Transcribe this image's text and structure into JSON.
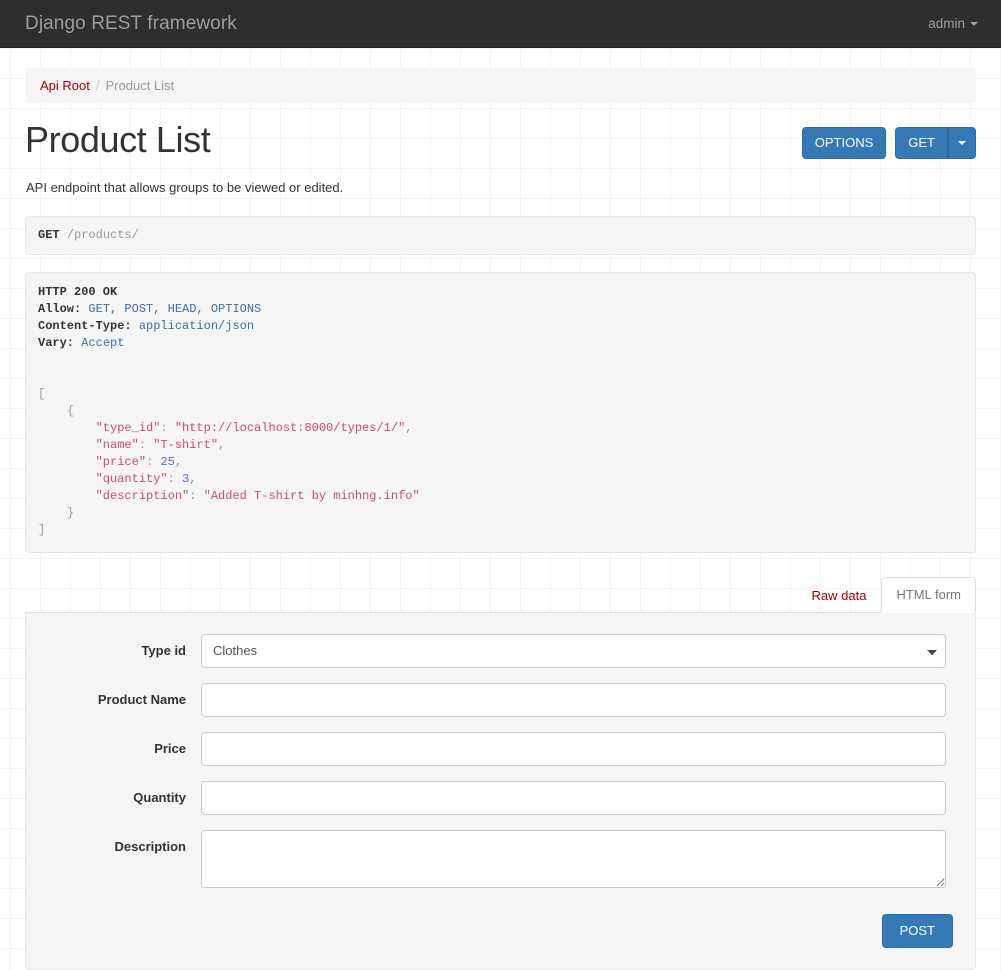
{
  "navbar": {
    "brand": "Django REST framework",
    "user": "admin",
    "caret_icon": "caret-down-icon"
  },
  "breadcrumb": {
    "root_label": "Api Root",
    "separator": "/",
    "current_label": "Product List"
  },
  "header": {
    "title": "Product List",
    "options_label": "OPTIONS",
    "get_label": "GET",
    "dropdown_icon": "caret-down-icon"
  },
  "description": "API endpoint that allows groups to be viewed or edited.",
  "request": {
    "method": "GET",
    "path": "/products/"
  },
  "response": {
    "status_line": "HTTP 200 OK",
    "headers": [
      {
        "key": "Allow:",
        "value": "GET, POST, HEAD, OPTIONS"
      },
      {
        "key": "Content-Type:",
        "value": "application/json"
      },
      {
        "key": "Vary:",
        "value": "Accept"
      }
    ],
    "body": {
      "open_bracket": "[",
      "open_brace": "{",
      "close_brace": "}",
      "close_bracket": "]",
      "fields": [
        {
          "key": "\"type_id\"",
          "colon": ": ",
          "value": "\"http://localhost:8000/types/1/\"",
          "type": "string",
          "comma": ","
        },
        {
          "key": "\"name\"",
          "colon": ": ",
          "value": "\"T-shirt\"",
          "type": "string",
          "comma": ","
        },
        {
          "key": "\"price\"",
          "colon": ": ",
          "value": "25",
          "type": "number",
          "comma": ","
        },
        {
          "key": "\"quantity\"",
          "colon": ": ",
          "value": "3",
          "type": "number",
          "comma": ","
        },
        {
          "key": "\"description\"",
          "colon": ": ",
          "value": "\"Added T-shirt by minhng.info\"",
          "type": "string",
          "comma": ""
        }
      ]
    }
  },
  "tabs": [
    {
      "label": "Raw data",
      "active": false
    },
    {
      "label": "HTML form",
      "active": true
    }
  ],
  "form": {
    "fields": [
      {
        "label": "Type id",
        "control": "select",
        "value": "Clothes",
        "placeholder": ""
      },
      {
        "label": "Product Name",
        "control": "text",
        "value": "",
        "placeholder": ""
      },
      {
        "label": "Price",
        "control": "text",
        "value": "",
        "placeholder": ""
      },
      {
        "label": "Quantity",
        "control": "text",
        "value": "",
        "placeholder": ""
      },
      {
        "label": "Description",
        "control": "textarea",
        "value": "",
        "placeholder": ""
      }
    ],
    "select_options": [
      "Clothes"
    ],
    "submit_label": "POST"
  },
  "colors": {
    "navbar_bg": "#2e2e2e",
    "primary": "#337ab7",
    "link_red": "#a30000",
    "panel_bg": "#f5f5f5",
    "json_string": "#d14874",
    "json_number": "#6a66d6",
    "header_value": "#3a70a8"
  }
}
